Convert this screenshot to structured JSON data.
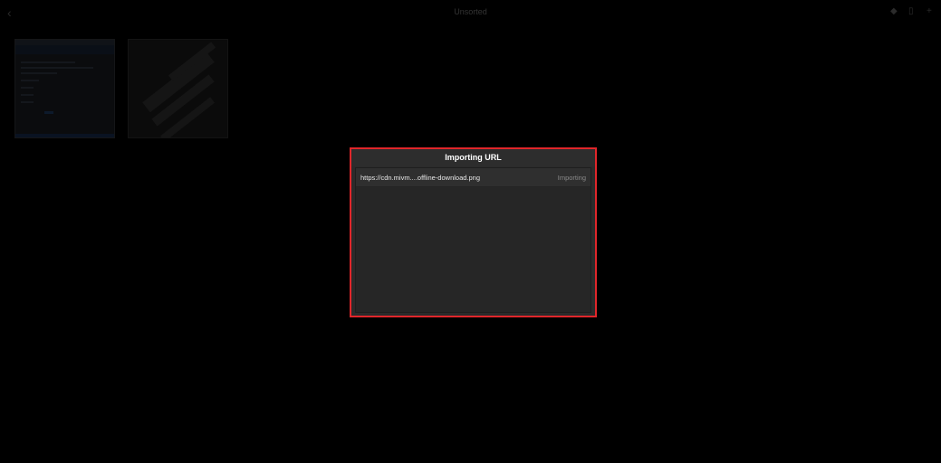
{
  "topbar": {
    "title": "Unsorted",
    "back_icon": "chevron-left-icon",
    "actions": [
      {
        "icon": "tag-icon",
        "glyph": "◆"
      },
      {
        "icon": "trash-icon",
        "glyph": "▯"
      },
      {
        "icon": "add-icon",
        "glyph": "+"
      }
    ]
  },
  "thumbnails": [
    {
      "kind": "screenshot"
    },
    {
      "kind": "photo"
    }
  ],
  "modal": {
    "title": "Importing URL",
    "items": [
      {
        "url": "https://cdn.mivm....offline-download.png",
        "status": "Importing"
      }
    ]
  },
  "colors": {
    "background": "#000000",
    "modal_border": "#e0262a",
    "modal_bg": "#2b2b2b",
    "row_bg": "#2f2f2f",
    "text": "#ffffff",
    "status_text": "#8a8a8a"
  }
}
